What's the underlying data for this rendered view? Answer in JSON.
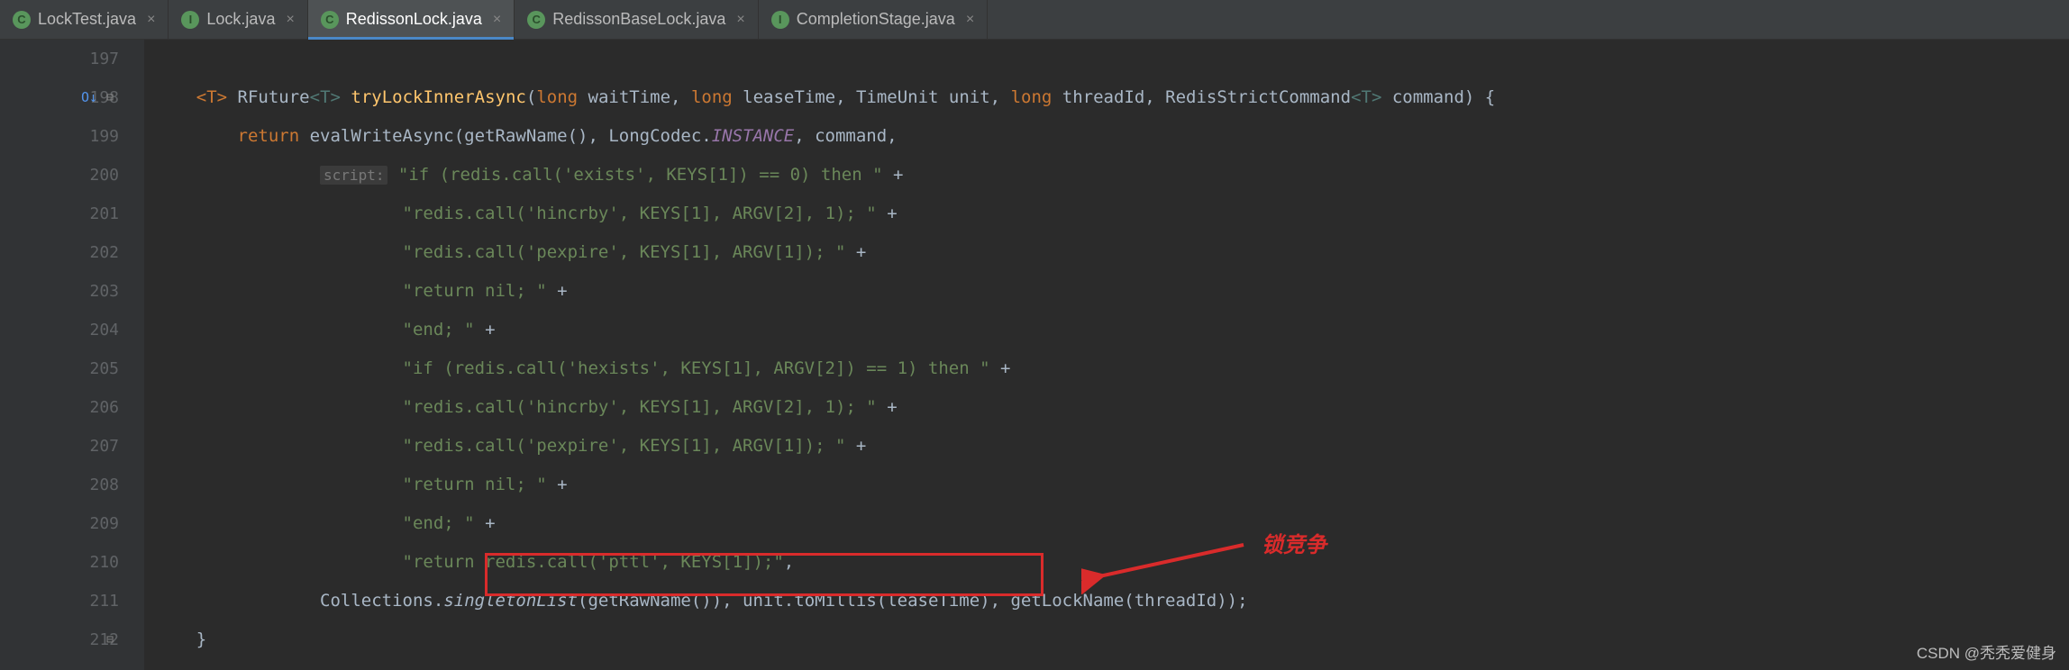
{
  "tabs": [
    {
      "label": "LockTest.java",
      "icon": "C",
      "active": false
    },
    {
      "label": "Lock.java",
      "icon": "I",
      "active": false
    },
    {
      "label": "RedissonLock.java",
      "icon": "C",
      "active": true
    },
    {
      "label": "RedissonBaseLock.java",
      "icon": "C",
      "active": false
    },
    {
      "label": "CompletionStage.java",
      "icon": "I",
      "active": false
    }
  ],
  "lines": {
    "197": "197",
    "198": "198",
    "199": "199",
    "200": "200",
    "201": "201",
    "202": "202",
    "203": "203",
    "204": "204",
    "205": "205",
    "206": "206",
    "207": "207",
    "208": "208",
    "209": "209",
    "210": "210",
    "211": "211",
    "212": "212"
  },
  "code": {
    "l198": {
      "kw1": "<T>",
      "type1": "RFuture",
      "tp1": "<T>",
      "method": "tryLockInnerAsync",
      "kw2": "long",
      "p1": " waitTime, ",
      "kw3": "long",
      "p2": " leaseTime, TimeUnit unit, ",
      "kw4": "long",
      "p3": " threadId, RedisStrictCommand",
      "tp2": "<T>",
      "p4": " command) {"
    },
    "l199": {
      "kw": "return",
      "text1": " evalWriteAsync(getRawName(), LongCodec.",
      "field": "INSTANCE",
      "text2": ", command,"
    },
    "l200": {
      "hint": "script:",
      "str": "\"if (redis.call('exists', KEYS[1]) == 0) then \"",
      "plus": " +"
    },
    "l201": {
      "str": "\"redis.call('hincrby', KEYS[1], ARGV[2], 1); \"",
      "plus": " +"
    },
    "l202": {
      "str": "\"redis.call('pexpire', KEYS[1], ARGV[1]); \"",
      "plus": " +"
    },
    "l203": {
      "str": "\"return nil; \"",
      "plus": " +"
    },
    "l204": {
      "str": "\"end; \"",
      "plus": " +"
    },
    "l205": {
      "str": "\"if (redis.call('hexists', KEYS[1], ARGV[2]) == 1) then \"",
      "plus": " +"
    },
    "l206": {
      "str": "\"redis.call('hincrby', KEYS[1], ARGV[2], 1); \"",
      "plus": " +"
    },
    "l207": {
      "str": "\"redis.call('pexpire', KEYS[1], ARGV[1]); \"",
      "plus": " +"
    },
    "l208": {
      "str": "\"return nil; \"",
      "plus": " +"
    },
    "l209": {
      "str": "\"end; \"",
      "plus": " +"
    },
    "l210": {
      "str": "\"return redis.call('pttl', KEYS[1]);\"",
      "comma": ","
    },
    "l211": {
      "text1": "Collections.",
      "method": "singletonList",
      "text2": "(getRawName()), unit.toMillis(leaseTime), getLockName(threadId));"
    },
    "l212": {
      "brace": "}"
    }
  },
  "annotation": "锁竞争",
  "watermark": "CSDN @秃秃爱健身"
}
